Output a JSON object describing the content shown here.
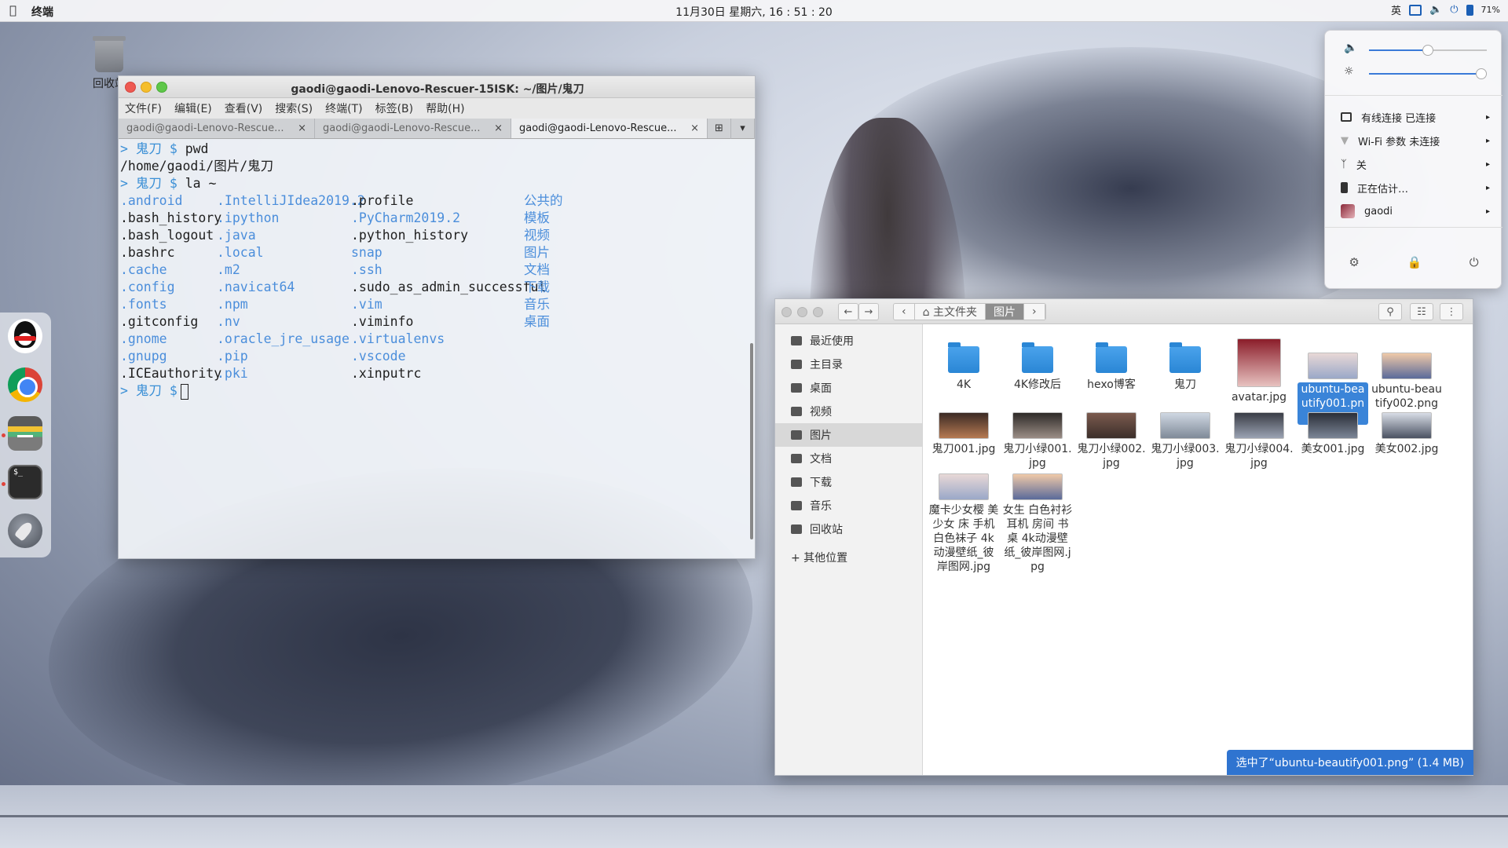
{
  "topbar": {
    "apple": "",
    "app_name": "终端",
    "clock": "11月30日 星期六, 16 : 51 : 20",
    "input_method": "英",
    "battery": "71%"
  },
  "desktop": {
    "trash_label": "回收站"
  },
  "terminal": {
    "title": "gaodi@gaodi-Lenovo-Rescuer-15ISK: ~/图片/鬼刀",
    "menu": [
      "文件(F)",
      "编辑(E)",
      "查看(V)",
      "搜索(S)",
      "终端(T)",
      "标签(B)",
      "帮助(H)"
    ],
    "tabs": [
      {
        "label": "gaodi@gaodi-Lenovo-Rescue...",
        "close": "×"
      },
      {
        "label": "gaodi@gaodi-Lenovo-Rescue...",
        "close": "×"
      },
      {
        "label": "gaodi@gaodi-Lenovo-Rescue...",
        "close": "×"
      }
    ],
    "new_tab_icon": "⊞",
    "menu_arrow": "▾",
    "prompt_arrow": ">",
    "prompt_dir": "鬼刀",
    "prompt_dollar": "$",
    "cmd1": "pwd",
    "out1": "/home/gaodi/图片/鬼刀",
    "cmd2": "la ~",
    "col1": [
      {
        "t": ".android",
        "d": true
      },
      {
        "t": ".bash_history",
        "d": false
      },
      {
        "t": ".bash_logout",
        "d": false
      },
      {
        "t": ".bashrc",
        "d": false
      },
      {
        "t": ".cache",
        "d": true
      },
      {
        "t": ".config",
        "d": true
      },
      {
        "t": ".fonts",
        "d": true
      },
      {
        "t": ".gitconfig",
        "d": false
      },
      {
        "t": ".gnome",
        "d": true
      },
      {
        "t": ".gnupg",
        "d": true
      },
      {
        "t": ".ICEauthority",
        "d": false
      }
    ],
    "col2": [
      {
        "t": ".IntelliJIdea2019.2",
        "d": true
      },
      {
        "t": ".ipython",
        "d": true
      },
      {
        "t": ".java",
        "d": true
      },
      {
        "t": ".local",
        "d": true
      },
      {
        "t": ".m2",
        "d": true
      },
      {
        "t": ".navicat64",
        "d": true
      },
      {
        "t": ".npm",
        "d": true
      },
      {
        "t": ".nv",
        "d": true
      },
      {
        "t": ".oracle_jre_usage",
        "d": true
      },
      {
        "t": ".pip",
        "d": true
      },
      {
        "t": ".pki",
        "d": true
      }
    ],
    "col3": [
      {
        "t": ".profile",
        "d": false
      },
      {
        "t": ".PyCharm2019.2",
        "d": true
      },
      {
        "t": ".python_history",
        "d": false
      },
      {
        "t": "snap",
        "d": true
      },
      {
        "t": ".ssh",
        "d": true
      },
      {
        "t": ".sudo_as_admin_successful",
        "d": false
      },
      {
        "t": ".vim",
        "d": true
      },
      {
        "t": ".viminfo",
        "d": false
      },
      {
        "t": ".virtualenvs",
        "d": true
      },
      {
        "t": ".vscode",
        "d": true
      },
      {
        "t": ".xinputrc",
        "d": false
      }
    ],
    "col4": [
      {
        "t": "公共的",
        "d": true
      },
      {
        "t": "模板",
        "d": true
      },
      {
        "t": "视频",
        "d": true
      },
      {
        "t": "图片",
        "d": true
      },
      {
        "t": "文档",
        "d": true
      },
      {
        "t": "下载",
        "d": true
      },
      {
        "t": "音乐",
        "d": true
      },
      {
        "t": "桌面",
        "d": true
      }
    ]
  },
  "files": {
    "back_icon": "←",
    "forward_icon": "→",
    "crumb_left": "‹",
    "crumb_home": "⌂ 主文件夹",
    "crumb_current": "图片",
    "crumb_right": "›",
    "search_icon": "⚲",
    "view_icon": "☷",
    "menu_icon": "⋮",
    "sidebar": [
      {
        "label": "最近使用",
        "icon": "clock-icon"
      },
      {
        "label": "主目录",
        "icon": "home-icon"
      },
      {
        "label": "桌面",
        "icon": "desktop-icon"
      },
      {
        "label": "视频",
        "icon": "video-icon"
      },
      {
        "label": "图片",
        "icon": "picture-icon",
        "active": true
      },
      {
        "label": "文档",
        "icon": "document-icon"
      },
      {
        "label": "下载",
        "icon": "download-icon"
      },
      {
        "label": "音乐",
        "icon": "music-icon"
      },
      {
        "label": "回收站",
        "icon": "trash-icon"
      }
    ],
    "other_places": "+ 其他位置",
    "items": [
      {
        "label": "4K",
        "kind": "folder"
      },
      {
        "label": "4K修改后",
        "kind": "folder"
      },
      {
        "label": "hexo博客",
        "kind": "folder"
      },
      {
        "label": "鬼刀",
        "kind": "folder"
      },
      {
        "label": "avatar.jpg",
        "kind": "portrait"
      },
      {
        "label": "ubuntu-beautify001.png",
        "kind": "wide",
        "selected": true
      },
      {
        "label": "ubuntu-beautify002.png",
        "kind": "wide"
      },
      {
        "label": "鬼刀001.jpg",
        "kind": "wide"
      },
      {
        "label": "鬼刀小绿001.jpg",
        "kind": "wide"
      },
      {
        "label": "鬼刀小绿002.jpg",
        "kind": "wide"
      },
      {
        "label": "鬼刀小绿003.jpg",
        "kind": "wide"
      },
      {
        "label": "鬼刀小绿004.jpg",
        "kind": "wide"
      },
      {
        "label": "美女001.jpg",
        "kind": "wide"
      },
      {
        "label": "美女002.jpg",
        "kind": "wide"
      },
      {
        "label": "魔卡少女樱 美少女 床 手机 白色袜子 4k动漫壁纸_彼岸图网.jpg",
        "kind": "wide"
      },
      {
        "label": "女生 白色衬衫 耳机 房间 书桌 4k动漫壁纸_彼岸图网.jpg",
        "kind": "wide"
      }
    ],
    "status": "选中了“ubuntu-beautify001.png” (1.4 MB)"
  },
  "system_menu": {
    "volume_level": 0.5,
    "brightness_level": 0.95,
    "wired": "有线连接 已连接",
    "wifi": "Wi-Fi 参数 未连接",
    "bluetooth": "关",
    "battery": "正在估计…",
    "user": "gaodi",
    "arrow": "▸"
  },
  "colors": {
    "accent": "#3a84d8",
    "terminal_dir": "#4b8edb",
    "folder": "#2a86d5"
  }
}
